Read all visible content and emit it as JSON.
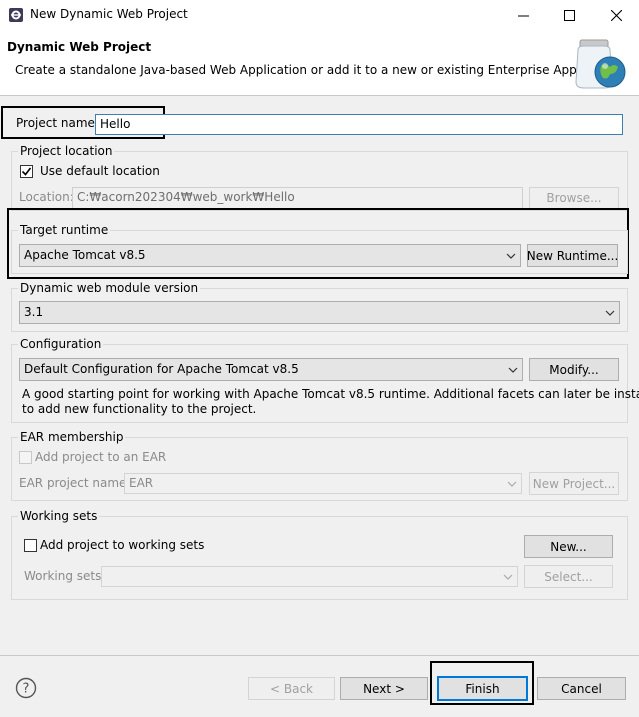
{
  "window": {
    "title": "New Dynamic Web Project",
    "controls": {
      "minimize": "minimize-icon",
      "maximize": "maximize-icon",
      "close": "close-icon"
    }
  },
  "banner": {
    "title": "Dynamic Web Project",
    "description": "Create a standalone Java-based Web Application or add it to a new or existing Enterprise Application."
  },
  "project_name": {
    "label": "Project name:",
    "value": "Hello"
  },
  "project_location": {
    "group_label": "Project location",
    "use_default_label": "Use default location",
    "use_default_checked": true,
    "location_label": "Location:",
    "location_value": "C:₩acorn202304₩web_work₩Hello",
    "browse_label": "Browse..."
  },
  "target_runtime": {
    "group_label": "Target runtime",
    "selected": "Apache Tomcat v8.5",
    "new_runtime_label": "New Runtime..."
  },
  "module_version": {
    "group_label": "Dynamic web module version",
    "selected": "3.1"
  },
  "configuration": {
    "group_label": "Configuration",
    "selected": "Default Configuration for Apache Tomcat v8.5",
    "modify_label": "Modify...",
    "description_line1": "A good starting point for working with Apache Tomcat v8.5 runtime. Additional facets can later be installed",
    "description_line2": "to add new functionality to the project."
  },
  "ear": {
    "group_label": "EAR membership",
    "add_label": "Add project to an EAR",
    "project_name_label": "EAR project name:",
    "project_name_value": "EAR",
    "new_project_label": "New Project..."
  },
  "working_sets": {
    "group_label": "Working sets",
    "add_label": "Add project to working sets",
    "new_label": "New...",
    "sets_label": "Working sets:",
    "select_label": "Select..."
  },
  "footer": {
    "help_icon": "help-icon",
    "back_label": "< Back",
    "next_label": "Next >",
    "finish_label": "Finish",
    "cancel_label": "Cancel"
  },
  "colors": {
    "focus_border": "#3c7fb1",
    "default_button_border": "#0078d7",
    "check_mark": "#000000"
  }
}
